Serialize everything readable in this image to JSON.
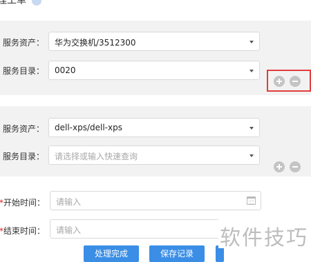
{
  "header": {
    "title_partial": "理工单"
  },
  "group1": {
    "asset_label": "服务资产：",
    "asset_value": "华为交换机/3512300",
    "catalog_label": "服务目录：",
    "catalog_value": "0020"
  },
  "group2": {
    "asset_label": "服务资产：",
    "asset_value": "dell-xps/dell-xps",
    "catalog_label": "服务目录：",
    "catalog_placeholder": "请选择或输入快速查询"
  },
  "time": {
    "required_mark": "*",
    "start_label": "开始时间：",
    "start_placeholder": "请输入",
    "end_label": "结束时间：",
    "end_placeholder": "请输入"
  },
  "actions": {
    "complete_label": "处理完成",
    "save_label": "保存记录"
  },
  "watermark": {
    "text": "软件技巧"
  },
  "colors": {
    "primary": "#3a8ee6",
    "highlight_box": "#e33b3b",
    "required": "#e02020"
  }
}
